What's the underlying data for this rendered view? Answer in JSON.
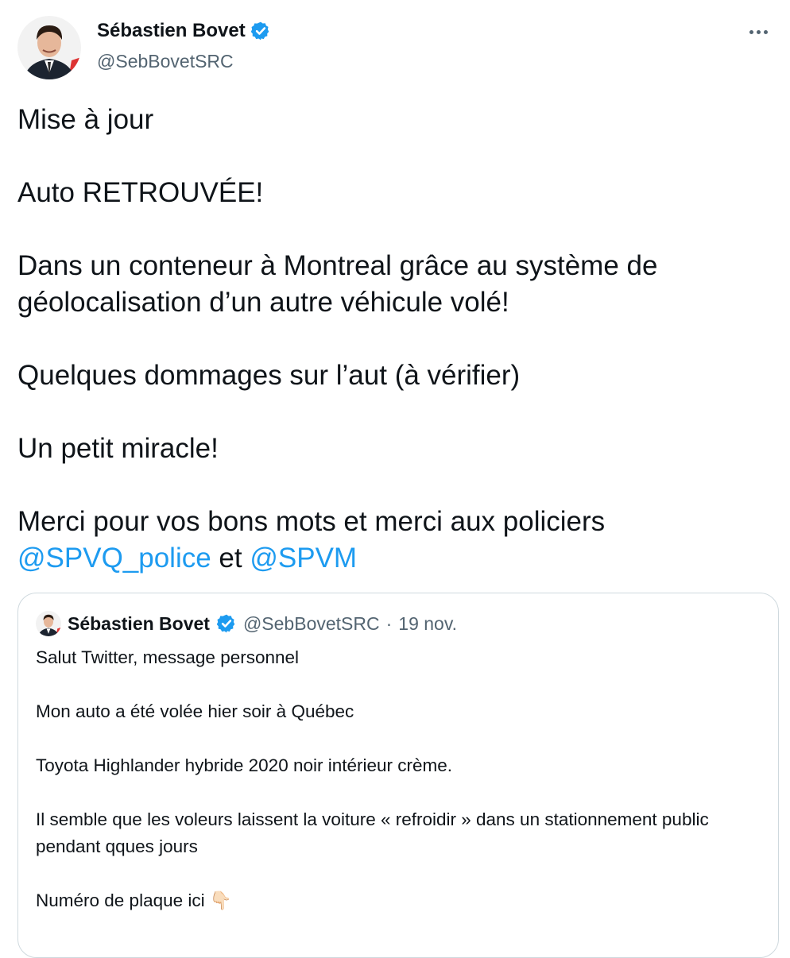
{
  "author": {
    "name": "Sébastien Bovet",
    "handle": "@SebBovetSRC",
    "verified": true
  },
  "tweet": {
    "lines": [
      "Mise à jour",
      "Auto RETROUVÉE!",
      "Dans un conteneur à Montreal grâce au système de géolocalisation d’un autre véhicule volé!",
      "Quelques dommages sur l’aut (à vérifier)",
      "Un petit miracle!",
      "Merci pour vos bons mots et merci aux policiers"
    ],
    "mention1": "@SPVQ_police",
    "connector": " et ",
    "mention2": "@SPVM"
  },
  "quote": {
    "name": "Sébastien Bovet",
    "handle": "@SebBovetSRC",
    "separator": "·",
    "date": "19 nov.",
    "lines": [
      "Salut Twitter, message personnel",
      "Mon auto a été volée hier soir à Québec",
      "Toyota Highlander hybride 2020 noir intérieur crème.",
      "Il semble que les voleurs laissent la voiture « refroidir » dans un stationnement public pendant qques jours",
      "Numéro de plaque ici 👇🏻"
    ]
  },
  "colors": {
    "accent": "#1d9bf0",
    "secondary_text": "#536471",
    "border": "#cfd9de"
  },
  "icons": [
    "verified-badge-icon",
    "more-options-icon",
    "avatar-photo"
  ]
}
